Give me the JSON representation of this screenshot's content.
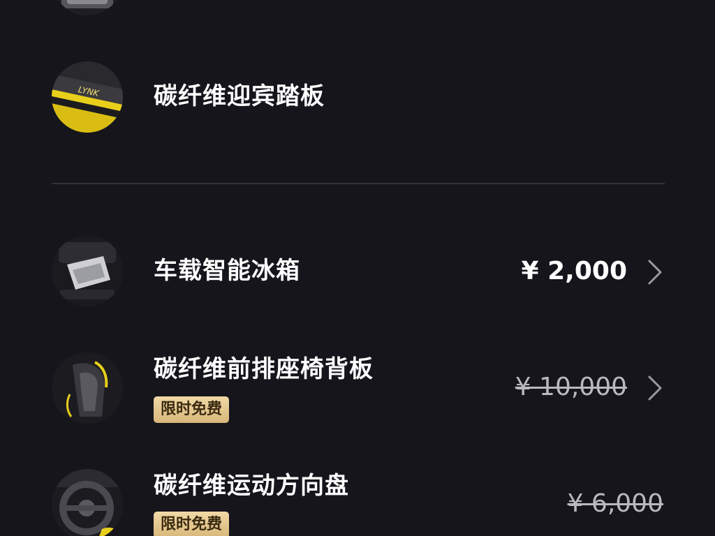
{
  "accessories": [
    {
      "name": "碳纤维迎宾踏板",
      "icon": "carbon-fiber-door-sill-thumbnail"
    },
    {
      "name": "车载智能冰箱",
      "icon": "car-fridge-thumbnail",
      "price": "¥ 2,000"
    },
    {
      "name": "碳纤维前排座椅背板",
      "icon": "carbon-fiber-seat-back-thumbnail",
      "badge": "限时免费",
      "original_price": "¥ 10,000"
    },
    {
      "name": "碳纤维运动方向盘",
      "icon": "carbon-fiber-steering-wheel-thumbnail",
      "badge": "限时免费",
      "original_price": "¥ 6,000"
    }
  ],
  "colors": {
    "background": "#16151c",
    "divider": "#33323a",
    "badge_gold": "#e3c58d",
    "strike_price": "#b9b9be",
    "accent_yellow": "#e8cf1c"
  }
}
